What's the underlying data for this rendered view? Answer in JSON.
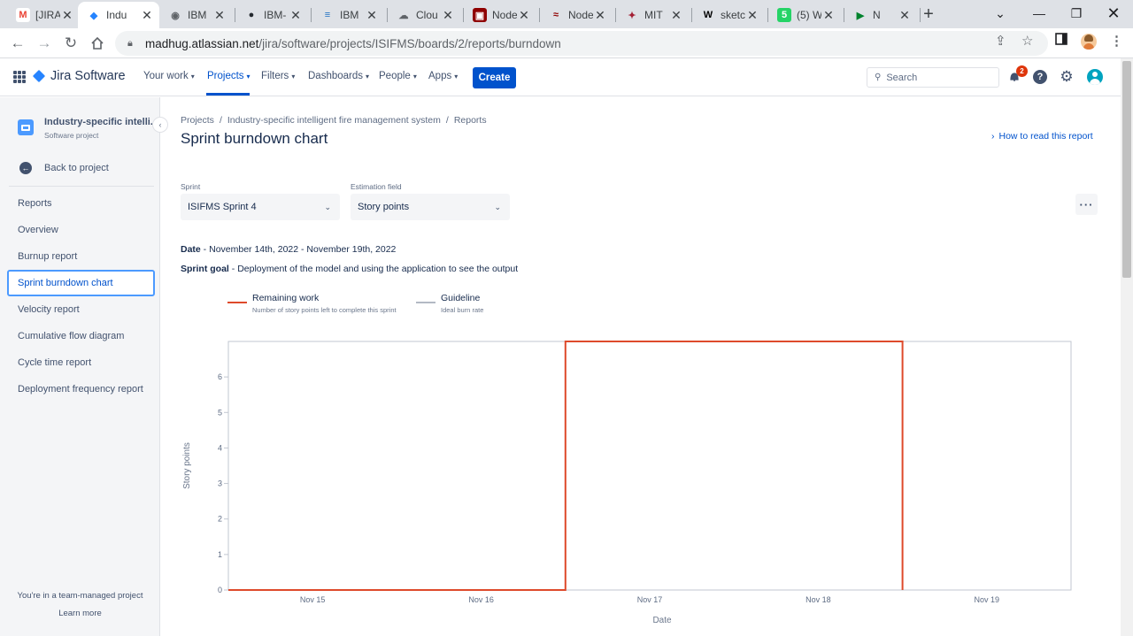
{
  "browser": {
    "tabs": [
      {
        "title": "[JIRA",
        "icon": "gmail-icon",
        "active": false
      },
      {
        "title": "Indu",
        "icon": "jira-icon",
        "active": true
      },
      {
        "title": "IBM",
        "icon": "globe-icon",
        "active": false
      },
      {
        "title": "IBM-",
        "icon": "github-icon",
        "active": false
      },
      {
        "title": "IBM",
        "icon": "ibm-icon",
        "active": false
      },
      {
        "title": "Clou",
        "icon": "cloud-icon",
        "active": false
      },
      {
        "title": "Node",
        "icon": "node-red-icon",
        "active": false
      },
      {
        "title": "Node",
        "icon": "node-icon",
        "active": false
      },
      {
        "title": "MIT",
        "icon": "mit-icon",
        "active": false
      },
      {
        "title": "sketc",
        "icon": "wikipedia-icon",
        "active": false
      },
      {
        "title": "(5) W",
        "icon": "whatsapp-icon",
        "active": false
      },
      {
        "title": "N",
        "icon": "meet-icon",
        "active": false
      }
    ],
    "url_host": "madhug.atlassian.net",
    "url_path": "/jira/software/projects/ISIFMS/boards/2/reports/burndown"
  },
  "jira_nav": {
    "product": "Jira Software",
    "items": [
      {
        "label": "Your work"
      },
      {
        "label": "Projects"
      },
      {
        "label": "Filters"
      },
      {
        "label": "Dashboards"
      },
      {
        "label": "People"
      },
      {
        "label": "Apps"
      }
    ],
    "create_label": "Create",
    "search_placeholder": "Search",
    "notification_count": "2",
    "accent_color": "#0052cc"
  },
  "sidebar": {
    "project_name": "Industry-specific intelli...",
    "project_type": "Software project",
    "back_label": "Back to project",
    "items": [
      {
        "label": "Reports"
      },
      {
        "label": "Overview"
      },
      {
        "label": "Burnup report"
      },
      {
        "label": "Sprint burndown chart",
        "selected": true
      },
      {
        "label": "Velocity report"
      },
      {
        "label": "Cumulative flow diagram"
      },
      {
        "label": "Cycle time report"
      },
      {
        "label": "Deployment frequency report"
      }
    ],
    "footer_text": "You're in a team-managed project",
    "footer_link": "Learn more"
  },
  "main": {
    "breadcrumbs": [
      "Projects",
      "Industry-specific intelligent fire management system",
      "Reports"
    ],
    "title": "Sprint burndown chart",
    "help_link": "How to read this report",
    "sprint_label": "Sprint",
    "sprint_value": "ISIFMS Sprint 4",
    "estimation_label": "Estimation field",
    "estimation_value": "Story points",
    "date_label": "Date",
    "date_value": "November 14th, 2022 - November 19th, 2022",
    "goal_label": "Sprint goal",
    "goal_value": "Deployment of the model and using the application to see the output",
    "legend": [
      {
        "name": "Remaining work",
        "desc": "Number of story points left to complete this sprint",
        "color": "#de4a2b"
      },
      {
        "name": "Guideline",
        "desc": "Ideal burn rate",
        "color": "#b3b9c4"
      }
    ]
  },
  "chart_data": {
    "type": "line",
    "xlabel": "Date",
    "ylabel": "Story points",
    "x_ticks": [
      "Nov 15",
      "Nov 16",
      "Nov 17",
      "Nov 18",
      "Nov 19"
    ],
    "y_ticks": [
      0,
      1,
      2,
      3,
      4,
      5,
      6
    ],
    "xlim": [
      "2022-11-14T12:00",
      "2022-11-19T12:00"
    ],
    "ylim": [
      0,
      7
    ],
    "series": [
      {
        "name": "Remaining work",
        "color": "#de4a2b",
        "points": [
          {
            "x": "2022-11-14T12:00",
            "y": 0
          },
          {
            "x": "2022-11-16T12:00",
            "y": 0
          },
          {
            "x": "2022-11-16T12:00",
            "y": 7
          },
          {
            "x": "2022-11-18T12:00",
            "y": 7
          },
          {
            "x": "2022-11-18T12:00",
            "y": 0
          }
        ]
      }
    ]
  }
}
